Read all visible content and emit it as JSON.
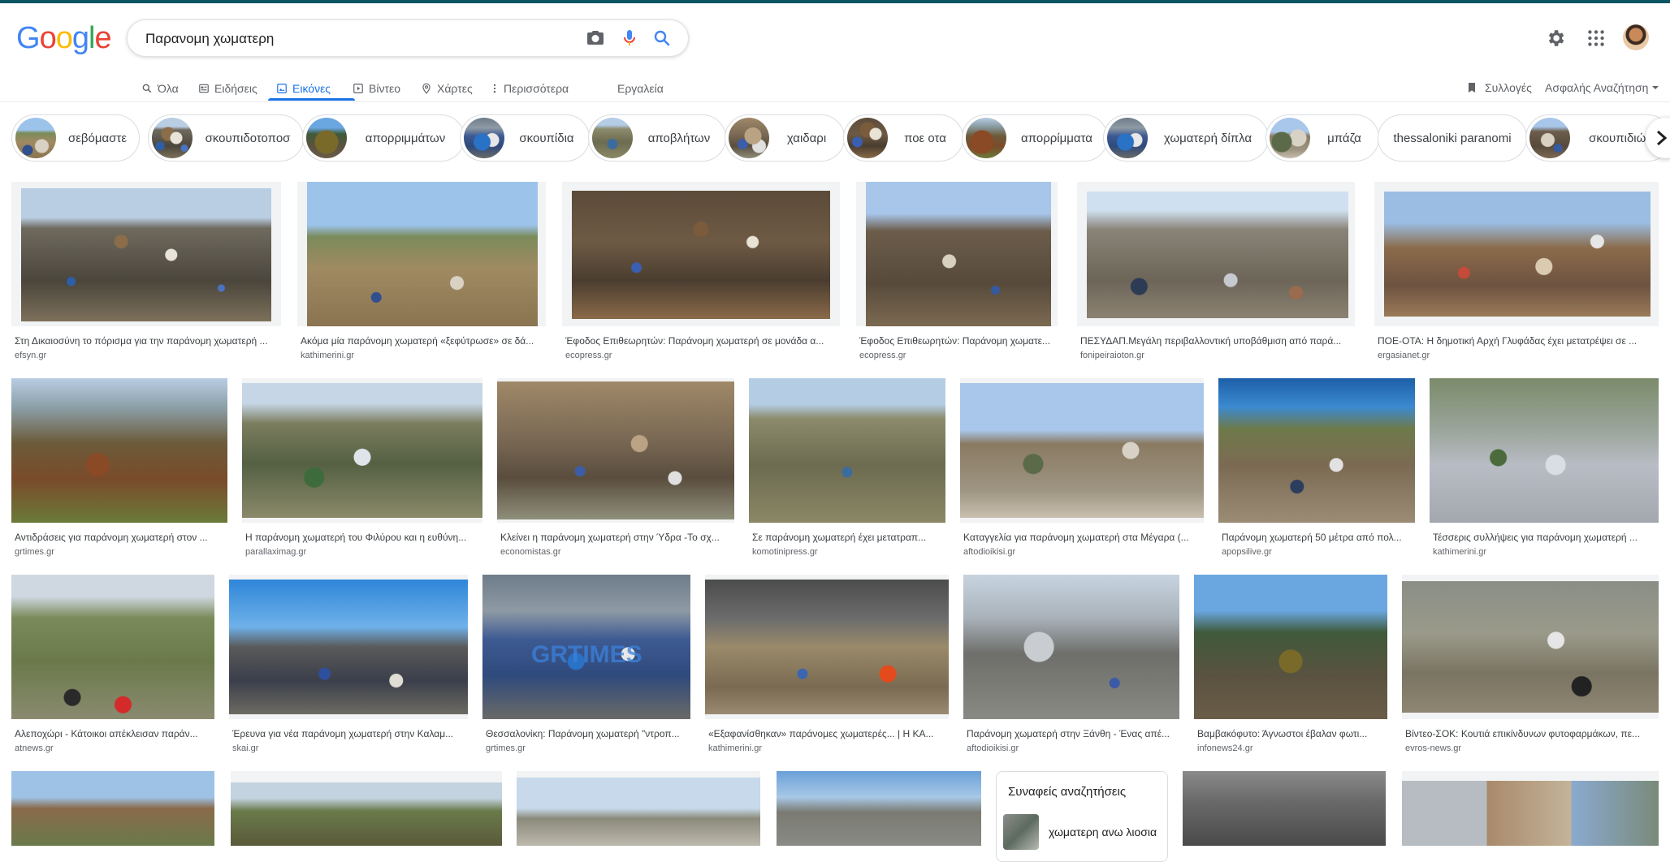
{
  "header": {
    "logo": "Google",
    "search_value": "Παρανομη χωματερη",
    "icons": [
      "camera-icon",
      "microphone-icon",
      "search-icon",
      "gear-icon",
      "apps-grid-icon",
      "avatar"
    ]
  },
  "tabs": [
    {
      "label": "Όλα",
      "icon": "search-icon"
    },
    {
      "label": "Ειδήσεις",
      "icon": "newspaper-icon"
    },
    {
      "label": "Εικόνες",
      "icon": "image-icon",
      "active": true
    },
    {
      "label": "Βίντεο",
      "icon": "play-icon"
    },
    {
      "label": "Χάρτες",
      "icon": "map-pin-icon"
    },
    {
      "label": "Περισσότερα",
      "icon": "more-vert-icon"
    },
    {
      "label": "Εργαλεία"
    }
  ],
  "right_links": {
    "collections": "Συλλογές",
    "safe_search": "Ασφαλής Αναζήτηση"
  },
  "chips": [
    "σεβόμαστε",
    "σκουπιδοτοποσ",
    "απορριμμάτων",
    "σκουπίδια",
    "αποβλήτων",
    "χαιδαρι",
    "ποε οτα",
    "απορρίμματα",
    "χωματερή δίπλα",
    "μπάζα",
    "thessaloniki paranomi",
    "σκουπιδιών"
  ],
  "results": [
    {
      "title": "Στη Δικαιοσύνη το πόρισμα για την παράνομη χωματερή ...",
      "source": "efsyn.gr"
    },
    {
      "title": "Ακόμα μία παράνομη χωματερή «ξεφύτρωσε» σε δά...",
      "source": "kathimerini.gr"
    },
    {
      "title": "Έφοδος Επιθεωρητών: Παράνομη χωματερή σε μονάδα α...",
      "source": "ecopress.gr"
    },
    {
      "title": "Έφοδος Επιθεωρητών: Παράνομη χωματε...",
      "source": "ecopress.gr"
    },
    {
      "title": "ΠΕΣΥΔΑΠ.Μεγάλη περιβαλλοντική υποβάθμιση από παρά...",
      "source": "fonipeiraioton.gr"
    },
    {
      "title": "ΠΟΕ-ΟΤΑ: Η δημοτική Αρχή Γλυφάδας έχει μετατρέψει σε ...",
      "source": "ergasianet.gr"
    },
    {
      "title": "Αντιδράσεις για παράνομη χωματερή στον ...",
      "source": "grtimes.gr"
    },
    {
      "title": "Η παράνομη χωματερή του Φιλύρου και η ευθύνη...",
      "source": "parallaximag.gr"
    },
    {
      "title": "Κλείνει η παράνομη χωματερή στην Ύδρα -Το σχ...",
      "source": "economistas.gr"
    },
    {
      "title": "Σε παράνομη χωματερή έχει μετατραπ...",
      "source": "komotinipress.gr"
    },
    {
      "title": "Καταγγελία για παράνομη χωματερή στα Μέγαρα (...",
      "source": "aftodioikisi.gr"
    },
    {
      "title": "Παράνομη χωματερή 50 μέτρα από πολ...",
      "source": "apopsilive.gr"
    },
    {
      "title": "Τέσσερις συλλήψεις για παράνομη χωματερή ...",
      "source": "kathimerini.gr"
    },
    {
      "title": "Αλεποχώρι - Κάτοικοι απέκλεισαν παράν...",
      "source": "atnews.gr"
    },
    {
      "title": "Έρευνα για νέα παράνομη χωματερή στην Καλαμ...",
      "source": "skai.gr"
    },
    {
      "title": "Θεσσαλονίκη: Παράνομη χωματερή \"ντροπ...",
      "source": "grtimes.gr"
    },
    {
      "title": "«Εξαφανίσθηκαν» παράνομες χωματερές... | Η ΚΑ...",
      "source": "kathimerini.gr"
    },
    {
      "title": "Παράνομη χωματερή στην Ξάνθη - Ένας απέ...",
      "source": "aftodioikisi.gr"
    },
    {
      "title": "Βαμβακόφυτο: Άγνωστοι έβαλαν φωτι...",
      "source": "infonews24.gr"
    },
    {
      "title": "Βίντεο-ΣΟΚ: Κουτιά επικίνδυνων φυτοφαρμάκων, πε...",
      "source": "evros-news.gr"
    }
  ],
  "watermark": "GRTIMES",
  "related": {
    "title": "Συναφείς αναζητήσεις",
    "items": [
      "χωματερη ανω λιοσια"
    ]
  }
}
